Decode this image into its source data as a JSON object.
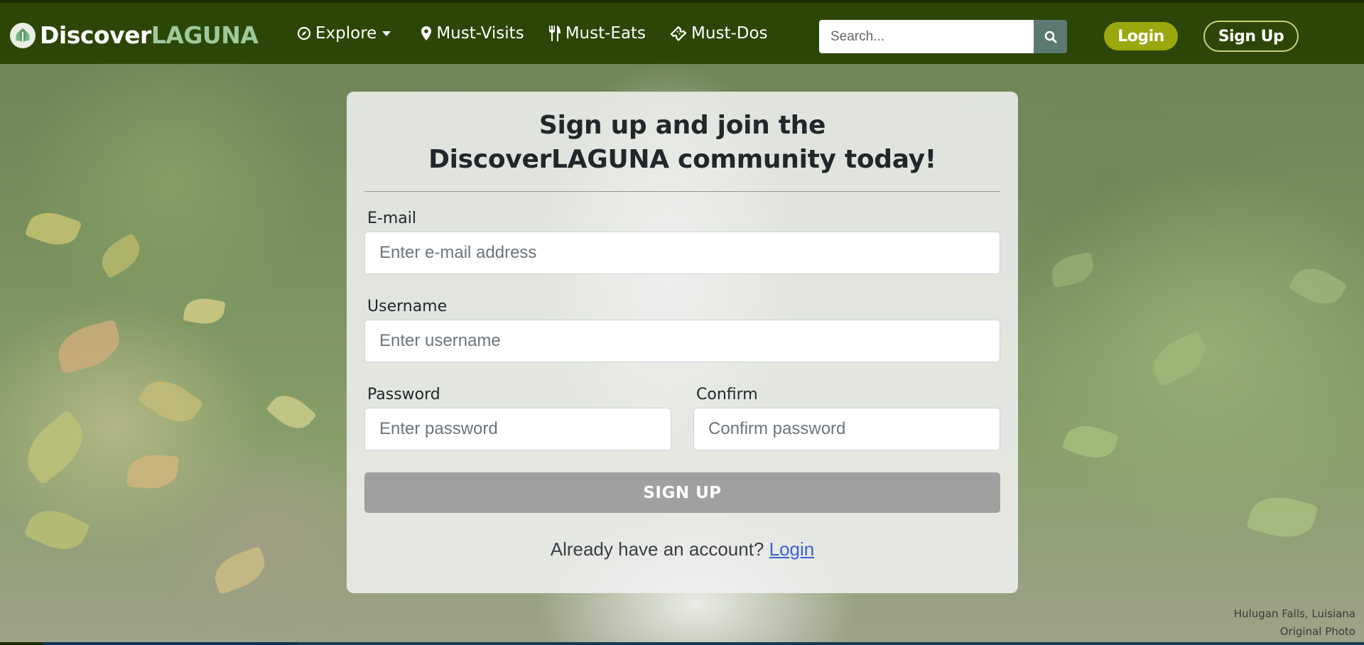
{
  "brand": {
    "part1": "Discover",
    "part2": "LAGUNA"
  },
  "nav": {
    "items": [
      {
        "label": "Explore",
        "icon": "compass-icon"
      },
      {
        "label": "Must-Visits",
        "icon": "map-pin-icon"
      },
      {
        "label": "Must-Eats",
        "icon": "utensils-icon"
      },
      {
        "label": "Must-Dos",
        "icon": "ticket-icon"
      }
    ],
    "search_placeholder": "Search...",
    "login_label": "Login",
    "signup_label": "Sign Up"
  },
  "form": {
    "title": "Sign up and join the DiscoverLAGUNA community today!",
    "email": {
      "label": "E-mail",
      "placeholder": "Enter e-mail address",
      "value": ""
    },
    "username": {
      "label": "Username",
      "placeholder": "Enter username",
      "value": ""
    },
    "password": {
      "label": "Password",
      "placeholder": "Enter password",
      "value": ""
    },
    "confirm": {
      "label": "Confirm",
      "placeholder": "Confirm password",
      "value": ""
    },
    "submit_label": "SIGN UP",
    "already_text": "Already have an account?",
    "login_link": "Login"
  },
  "photo_caption": {
    "line1": "Hulugan Falls, Luisiana",
    "line2": "Original Photo"
  },
  "colors": {
    "navbar_bg": "#2b4606",
    "brand_accent": "#9ec99a",
    "login_button": "#9aa80e",
    "submit_button": "#a0a0a0",
    "link": "#3b63d1"
  }
}
